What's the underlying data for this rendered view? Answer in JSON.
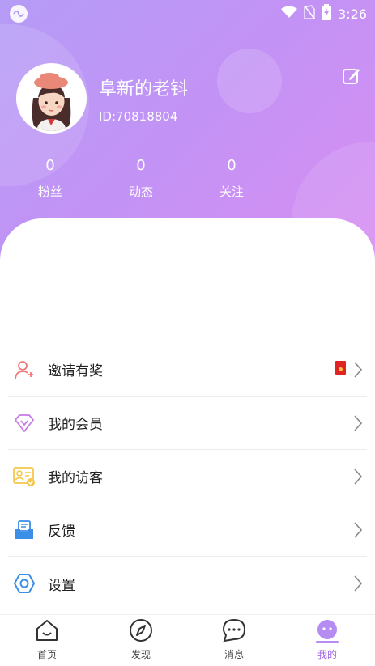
{
  "status_bar": {
    "time": "3:26"
  },
  "profile": {
    "nickname": "阜新的老钭",
    "user_id": "ID:70818804",
    "stats": [
      {
        "count": "0",
        "label": "粉丝"
      },
      {
        "count": "0",
        "label": "动态"
      },
      {
        "count": "0",
        "label": "关注"
      }
    ]
  },
  "menu": {
    "items": [
      {
        "label": "邀请有奖",
        "icon": "user-add-icon"
      },
      {
        "label": "我的会员",
        "icon": "diamond-icon"
      },
      {
        "label": "我的访客",
        "icon": "visitor-card-icon"
      },
      {
        "label": "反馈",
        "icon": "feedback-icon"
      },
      {
        "label": "设置",
        "icon": "settings-hexagon-icon"
      }
    ]
  },
  "bottom_nav": {
    "items": [
      {
        "label": "首页",
        "icon": "home-icon"
      },
      {
        "label": "发现",
        "icon": "compass-icon"
      },
      {
        "label": "消息",
        "icon": "chat-bubble-icon"
      },
      {
        "label": "我的",
        "icon": "face-icon",
        "active": true
      }
    ]
  },
  "colors": {
    "header_gradient_start": "#b59cf6",
    "header_gradient_end": "#d98ff1",
    "accent_purple": "#a066e8",
    "invite_icon": "#f07878",
    "member_icon": "#c77be8",
    "visitor_icon": "#f4c84a",
    "feedback_icon": "#3b8fe6",
    "settings_icon": "#3b8fe6"
  }
}
